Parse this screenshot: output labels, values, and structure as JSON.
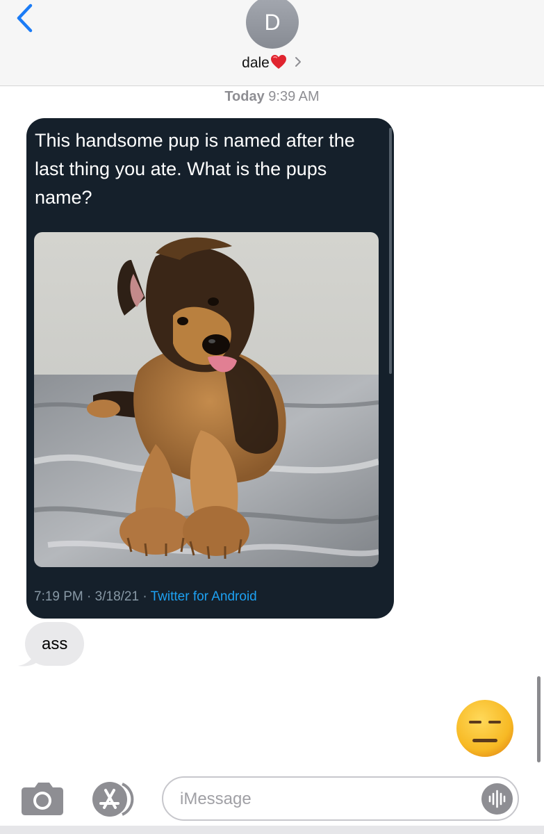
{
  "header": {
    "avatar_initial": "D",
    "contact_name": "dale",
    "back_icon": "chevron-left-icon",
    "detail_icon": "chevron-right-icon"
  },
  "timestamp": {
    "day": "Today",
    "time": "9:39 AM"
  },
  "tweet": {
    "text": "This handsome pup is named after the last thing you ate. What is the pups name?",
    "time": "7:19 PM",
    "separator": "·",
    "date": "3/18/21",
    "source": "Twitter for Android",
    "photo_subject": "german-shepherd-puppy",
    "background_color": "#15202b",
    "link_color": "#1da1f2"
  },
  "messages": [
    {
      "direction": "received",
      "text": "ass"
    }
  ],
  "reaction": {
    "emoji": "😑",
    "icon": "expressionless-face-icon"
  },
  "input": {
    "placeholder": "iMessage",
    "value": ""
  },
  "colors": {
    "accent": "#1b7cf6",
    "received_bubble": "#e9e9eb",
    "icon_gray": "#8e8e93"
  }
}
